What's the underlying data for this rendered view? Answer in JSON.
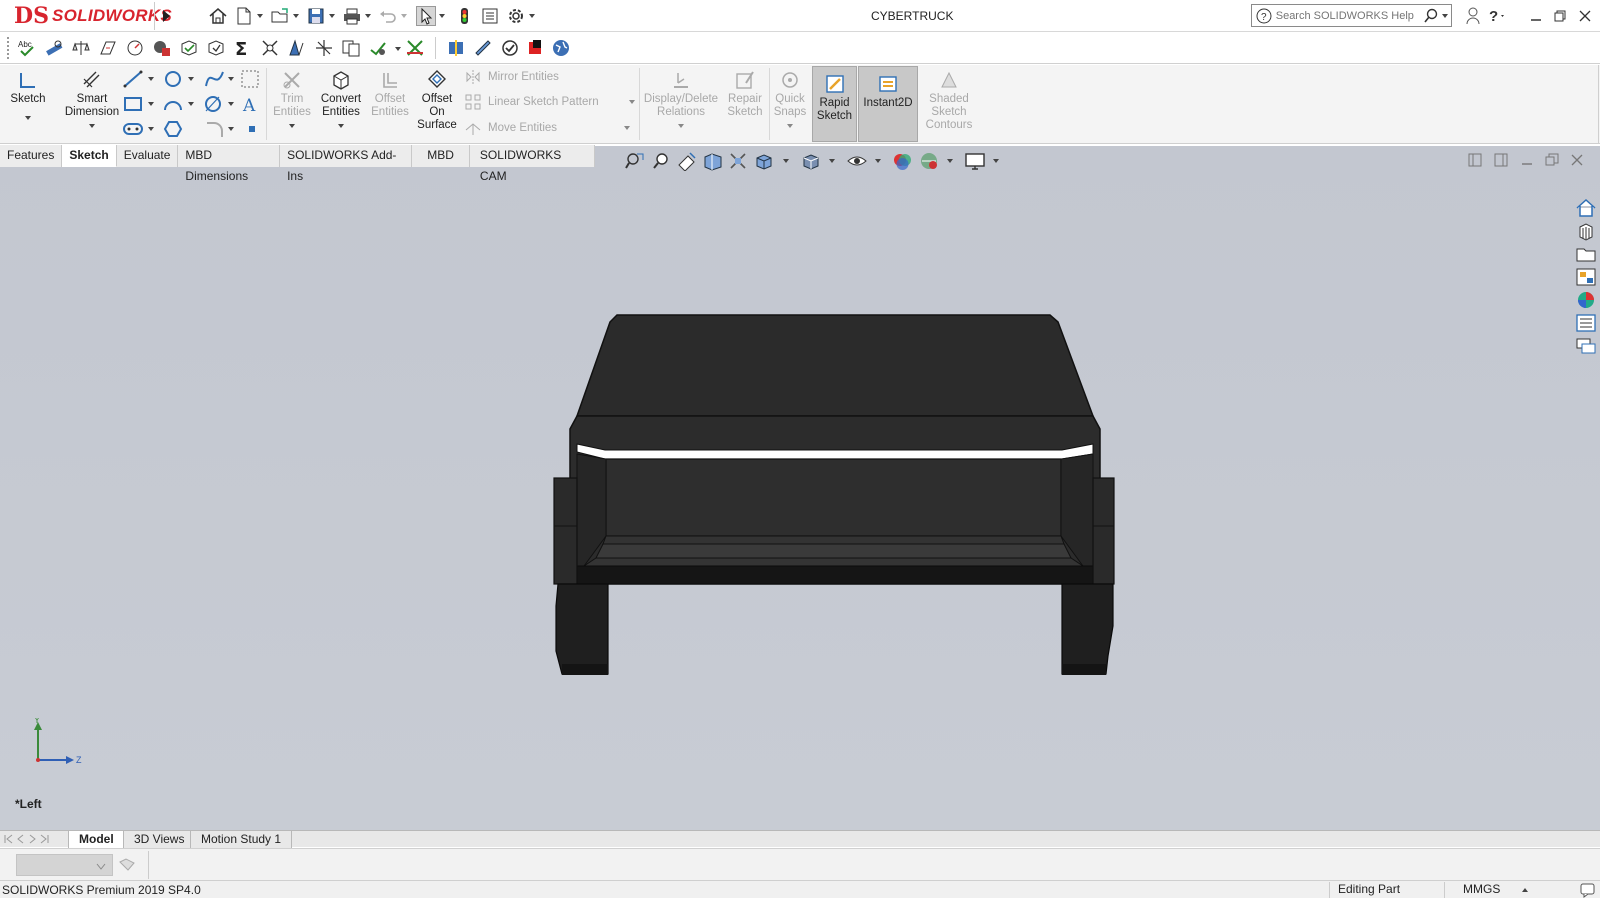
{
  "app": {
    "logo_mark": "DS",
    "logo_text": "SOLIDWORKS",
    "document_title": "CYBERTRUCK"
  },
  "search": {
    "placeholder": "Search SOLIDWORKS Help"
  },
  "ribbon": {
    "sketch": "Sketch",
    "smart_dimension": [
      "Smart",
      "Dimension"
    ],
    "trim_entities": [
      "Trim",
      "Entities"
    ],
    "convert_entities": [
      "Convert",
      "Entities"
    ],
    "offset_entities": [
      "Offset",
      "Entities"
    ],
    "offset_on_surface": [
      "Offset",
      "On",
      "Surface"
    ],
    "mirror_entities": "Mirror Entities",
    "linear_sketch_pattern": "Linear Sketch Pattern",
    "move_entities": "Move Entities",
    "display_delete_relations": [
      "Display/Delete",
      "Relations"
    ],
    "repair_sketch": [
      "Repair",
      "Sketch"
    ],
    "quick_snaps": [
      "Quick",
      "Snaps"
    ],
    "rapid_sketch": [
      "Rapid",
      "Sketch"
    ],
    "instant2d": "Instant2D",
    "shaded_sketch_contours": [
      "Shaded",
      "Sketch",
      "Contours"
    ]
  },
  "tabs": [
    "Features",
    "Sketch",
    "Evaluate",
    "MBD Dimensions",
    "SOLIDWORKS Add-Ins",
    "MBD",
    "SOLIDWORKS CAM"
  ],
  "active_tab": "Sketch",
  "viewport": {
    "view_name": "*Left",
    "axis_y": "Y",
    "axis_z": "Z"
  },
  "bottom_tabs": [
    "Model",
    "3D Views",
    "Motion Study 1"
  ],
  "status": {
    "product": "SOLIDWORKS Premium 2019 SP4.0",
    "mode": "Editing Part",
    "units": "MMGS"
  },
  "colors": {
    "brand_red": "#d8242e",
    "viewport_bg": "#c3c7d0",
    "model_dark": "#2b2b2b"
  }
}
